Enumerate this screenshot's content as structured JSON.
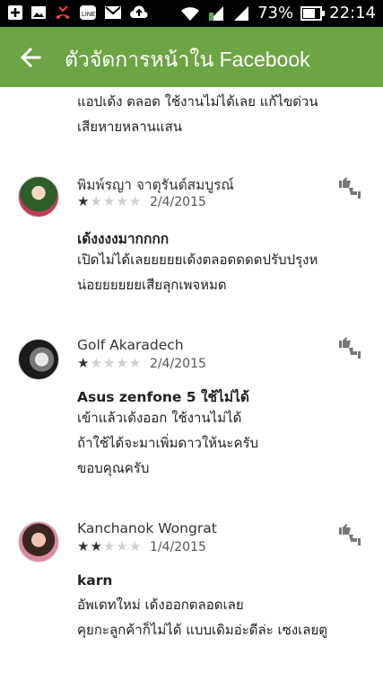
{
  "status_bar": {
    "battery": "73%",
    "time": "22:14",
    "left_icons": [
      "add-icon",
      "image-icon",
      "missed-call-icon",
      "line-icon",
      "mail-icon",
      "upload-icon"
    ],
    "right_icons": [
      "wifi-icon",
      "signal-1-icon",
      "signal-2-icon",
      "battery-icon"
    ]
  },
  "app_bar": {
    "title": "ตัวจัดการหน้าใน Facebook",
    "back_icon": "arrow-back-icon",
    "color": "#6ea544"
  },
  "partial_review": {
    "lines": [
      "แอปเด้ง ตลอด ใช้งานไม่ได้เลย แก้ไขด่วน",
      "เสียหายหลานแสน"
    ]
  },
  "reviews": [
    {
      "author": "พิมพ์รญา จาตุรันต์สมบูรณ์",
      "rating": 1,
      "date": "2/4/2015",
      "title": "เด้งงงงมากกกก",
      "body": [
        "เปิดไม่ได้เลยยยยยเด้งตลอดดดดปรับปรุงห",
        "น่อยยยยยยเสียลุกเพจหมด"
      ]
    },
    {
      "author": "Golf Akaradech",
      "rating": 1,
      "date": "2/4/2015",
      "title": "Asus zenfone 5 ใช้ไม่ได้",
      "body": [
        "เข้าแล้วเด้งออก ใช้งานไม่ได้",
        "ถ้าใช้ได้จะมาเพิ่มดาวให้นะครับ",
        "ขอบคุณครับ"
      ]
    },
    {
      "author": "Kanchanok Wongrat",
      "rating": 2,
      "date": "1/4/2015",
      "title": "karn",
      "body": [
        "อัพเดทใหม่ เด้งออกตลอดเลย",
        "คุยกะลูกค้าก็ไม่ได้ แบบเดิมอ่ะดีล่ะ เซงเลยตู"
      ]
    }
  ],
  "stars": {
    "symbol": "★",
    "max": 5
  }
}
